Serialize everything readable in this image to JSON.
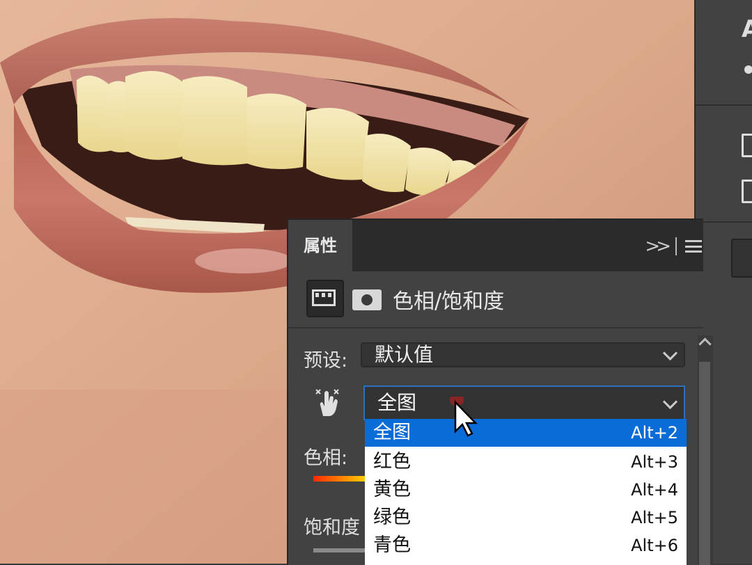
{
  "panel": {
    "tab_label": "属性",
    "header_title": "色相/饱和度",
    "preset_label": "预设:",
    "preset_value": "默认值",
    "range_value": "全图",
    "hue_label": "色相:",
    "saturation_label": "饱和度"
  },
  "dropdown": {
    "options": [
      {
        "label": "全图",
        "shortcut": "Alt+2",
        "selected": true
      },
      {
        "label": "红色",
        "shortcut": "Alt+3",
        "selected": false
      },
      {
        "label": "黄色",
        "shortcut": "Alt+4",
        "selected": false
      },
      {
        "label": "绿色",
        "shortcut": "Alt+5",
        "selected": false
      },
      {
        "label": "青色",
        "shortcut": "Alt+6",
        "selected": false
      }
    ]
  },
  "right_strip": {
    "letter": "A"
  },
  "colors": {
    "selection": "#0a6cd6",
    "focus_border": "#2f6fbf",
    "panel_bg": "#424242"
  }
}
